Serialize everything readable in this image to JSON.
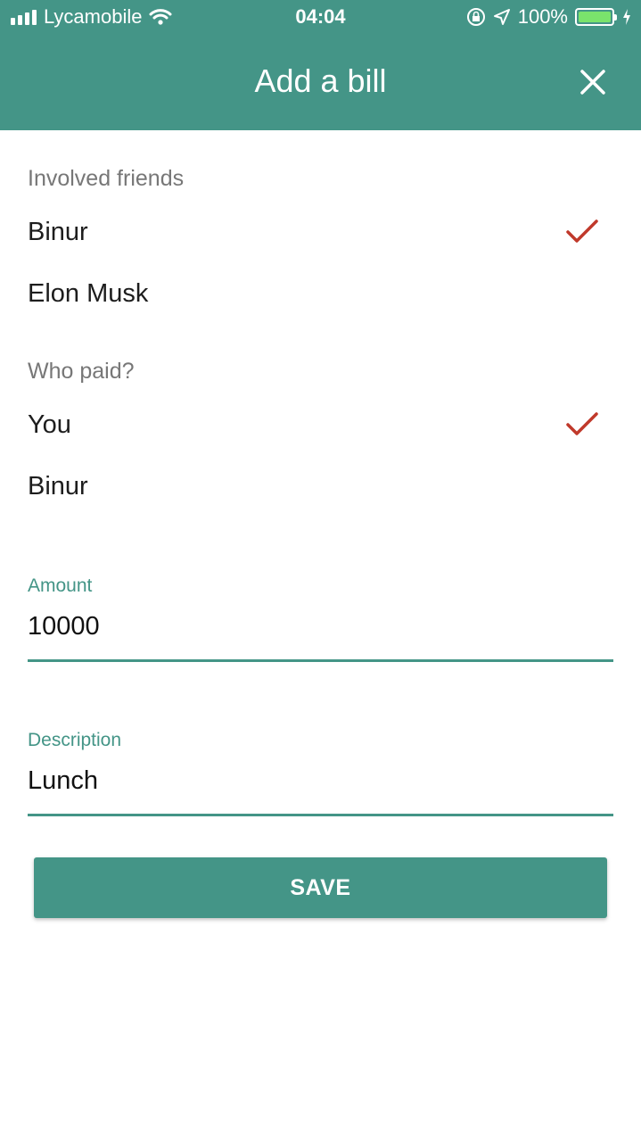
{
  "status_bar": {
    "carrier": "Lycamobile",
    "time": "04:04",
    "battery_percent": "100%",
    "battery_level": 1.0
  },
  "header": {
    "title": "Add a bill",
    "close_icon": "close-icon",
    "background": "#449587"
  },
  "involved_friends": {
    "label": "Involved friends",
    "items": [
      {
        "name": "Binur",
        "checked": true
      },
      {
        "name": "Elon Musk",
        "checked": false
      }
    ]
  },
  "who_paid": {
    "label": "Who paid?",
    "items": [
      {
        "name": "You",
        "checked": true
      },
      {
        "name": "Binur",
        "checked": false
      }
    ]
  },
  "amount": {
    "label": "Amount",
    "value": "10000"
  },
  "description": {
    "label": "Description",
    "value": "Lunch"
  },
  "save_button": {
    "label": "SAVE"
  },
  "colors": {
    "accent": "#449587",
    "check": "#c0392b",
    "section_label": "#777777"
  }
}
